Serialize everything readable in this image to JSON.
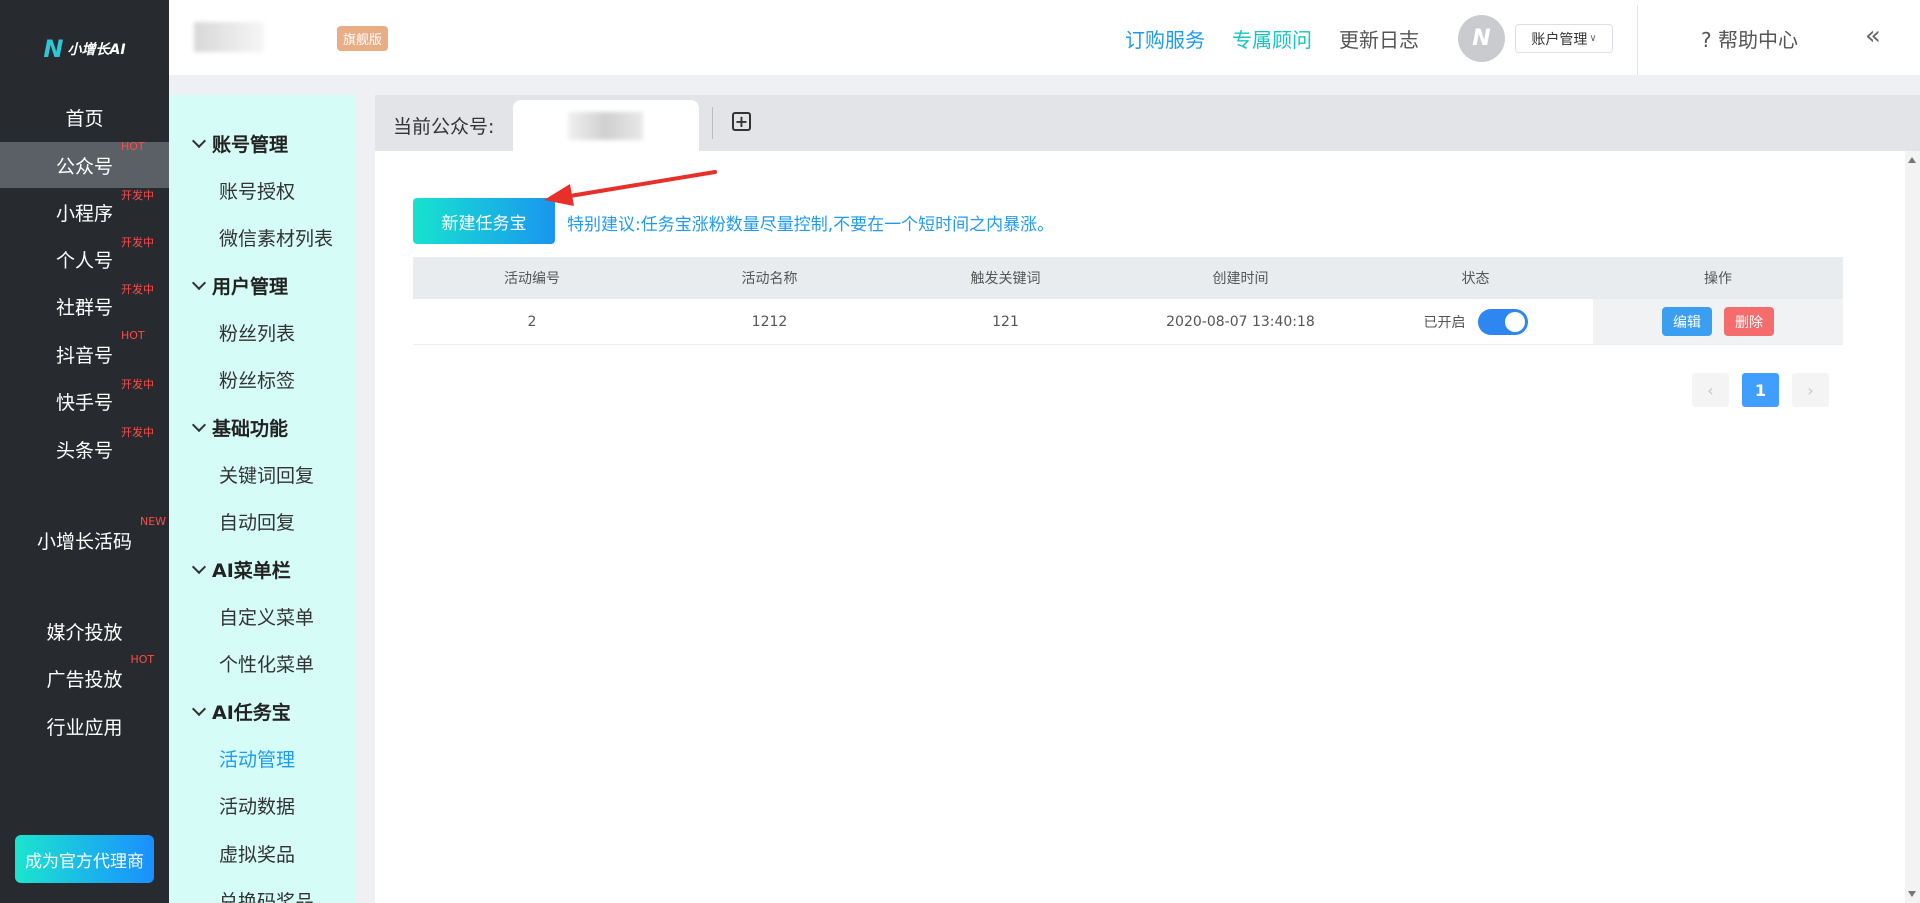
{
  "brand": {
    "logo_text": "小增长AI"
  },
  "main_nav": [
    {
      "label": "首页",
      "badge": ""
    },
    {
      "label": "公众号",
      "badge": "HOT"
    },
    {
      "label": "小程序",
      "badge": "开发中"
    },
    {
      "label": "个人号",
      "badge": "开发中"
    },
    {
      "label": "社群号",
      "badge": "开发中"
    },
    {
      "label": "抖音号",
      "badge": "HOT"
    },
    {
      "label": "快手号",
      "badge": "开发中"
    },
    {
      "label": "头条号",
      "badge": "开发中"
    },
    {
      "label": "小增长活码",
      "badge": "NEW"
    },
    {
      "label": "媒介投放",
      "badge": ""
    },
    {
      "label": "广告投放",
      "badge": "HOT"
    },
    {
      "label": "行业应用",
      "badge": ""
    }
  ],
  "agent_button": "成为官方代理商",
  "header": {
    "edition_badge": "旗舰版",
    "links": [
      "订购服务",
      "专属顾问",
      "更新日志"
    ],
    "account_menu": "账户管理",
    "help": "帮助中心",
    "collapse_icon": "«",
    "colors": {
      "order": "#1f9bf0",
      "advisor": "#16c5c0",
      "changelog": "#555555"
    }
  },
  "sub_menu": {
    "groups": [
      {
        "title": "账号管理",
        "items": [
          "账号授权",
          "微信素材列表"
        ]
      },
      {
        "title": "用户管理",
        "items": [
          "粉丝列表",
          "粉丝标签"
        ]
      },
      {
        "title": "基础功能",
        "items": [
          "关键词回复",
          "自动回复"
        ]
      },
      {
        "title": "AI菜单栏",
        "items": [
          "自定义菜单",
          "个性化菜单"
        ]
      },
      {
        "title": "AI任务宝",
        "items": [
          "活动管理",
          "活动数据",
          "虚拟奖品",
          "兑换码奖品"
        ]
      }
    ],
    "active_item": "活动管理"
  },
  "tabbar": {
    "label": "当前公众号:"
  },
  "content": {
    "new_button": "新建任务宝",
    "tip": "特别建议:任务宝涨粉数量尽量控制,不要在一个短时间之内暴涨。",
    "table": {
      "headers": [
        "活动编号",
        "活动名称",
        "触发关键词",
        "创建时间",
        "状态",
        "操作"
      ],
      "rows": [
        {
          "id": "2",
          "name": "1212",
          "keyword": "121",
          "created": "2020-08-07 13:40:18",
          "status": "已开启",
          "enabled": true,
          "edit": "编辑",
          "delete": "删除"
        }
      ]
    },
    "pagination": {
      "current": "1",
      "prev_icon": "‹",
      "next_icon": "›"
    }
  }
}
